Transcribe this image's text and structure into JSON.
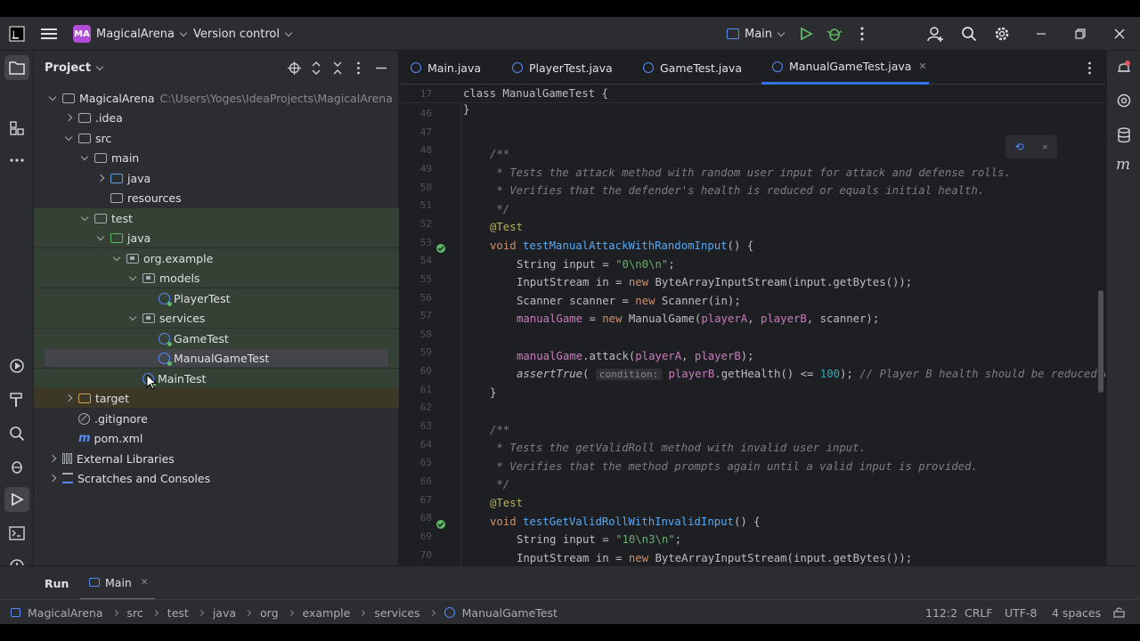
{
  "titlebar": {
    "project_badge": "MA",
    "project_name": "MagicalArena",
    "vcs": "Version control",
    "run_config": "Main"
  },
  "project_panel": {
    "title": "Project",
    "tree": [
      {
        "label": "MagicalArena",
        "extra": "C:\\Users\\Yoges\\IdeaProjects\\MagicalArena"
      },
      {
        "label": ".idea"
      },
      {
        "label": "src"
      },
      {
        "label": "main"
      },
      {
        "label": "java"
      },
      {
        "label": "resources"
      },
      {
        "label": "test"
      },
      {
        "label": "java"
      },
      {
        "label": "org.example"
      },
      {
        "label": "models"
      },
      {
        "label": "PlayerTest"
      },
      {
        "label": "services"
      },
      {
        "label": "GameTest"
      },
      {
        "label": "ManualGameTest"
      },
      {
        "label": "MainTest"
      },
      {
        "label": "target"
      },
      {
        "label": ".gitignore"
      },
      {
        "label": "pom.xml"
      },
      {
        "label": "External Libraries"
      },
      {
        "label": "Scratches and Consoles"
      }
    ]
  },
  "tabs": [
    "Main.java",
    "PlayerTest.java",
    "GameTest.java",
    "ManualGameTest.java"
  ],
  "editor": {
    "sticky_line": "17",
    "sticky_code": "class ManualGameTest {",
    "line_numbers": [
      "46",
      "47",
      "48",
      "49",
      "50",
      "51",
      "52",
      "53",
      "54",
      "55",
      "56",
      "57",
      "58",
      "59",
      "60",
      "61",
      "62",
      "63",
      "64",
      "65",
      "66",
      "67",
      "68",
      "69",
      "70"
    ],
    "doc1_l1": " * Tests the attack method with random user input for attack and defense rolls.",
    "doc1_l2": " * Verifies that the defender's health is reduced or equals initial health.",
    "doc2_l1": " * Tests the getValidRoll method with invalid user input.",
    "doc2_l2": " * Verifies that the method prompts again until a valid input is provided.",
    "method1": "testManualAttackWithRandomInput",
    "method2": "testGetValidRollWithInvalidInput",
    "input1": "\"0\\n0\\n\"",
    "input2": "\"10\\n3\\n\"",
    "hint": "condition:",
    "comment_trail": "// Player B health should be reduced or"
  },
  "runbar": {
    "run": "Run",
    "tab": "Main"
  },
  "statusbar": {
    "breadcrumbs": [
      "MagicalArena",
      "src",
      "test",
      "java",
      "org",
      "example",
      "services",
      "ManualGameTest"
    ],
    "position": "112:2",
    "line_sep": "CRLF",
    "encoding": "UTF-8",
    "indent": "4 spaces"
  },
  "colors": {
    "accent": "#3574f0",
    "green_bg": "#344134",
    "olive_bg": "#3c3828"
  }
}
